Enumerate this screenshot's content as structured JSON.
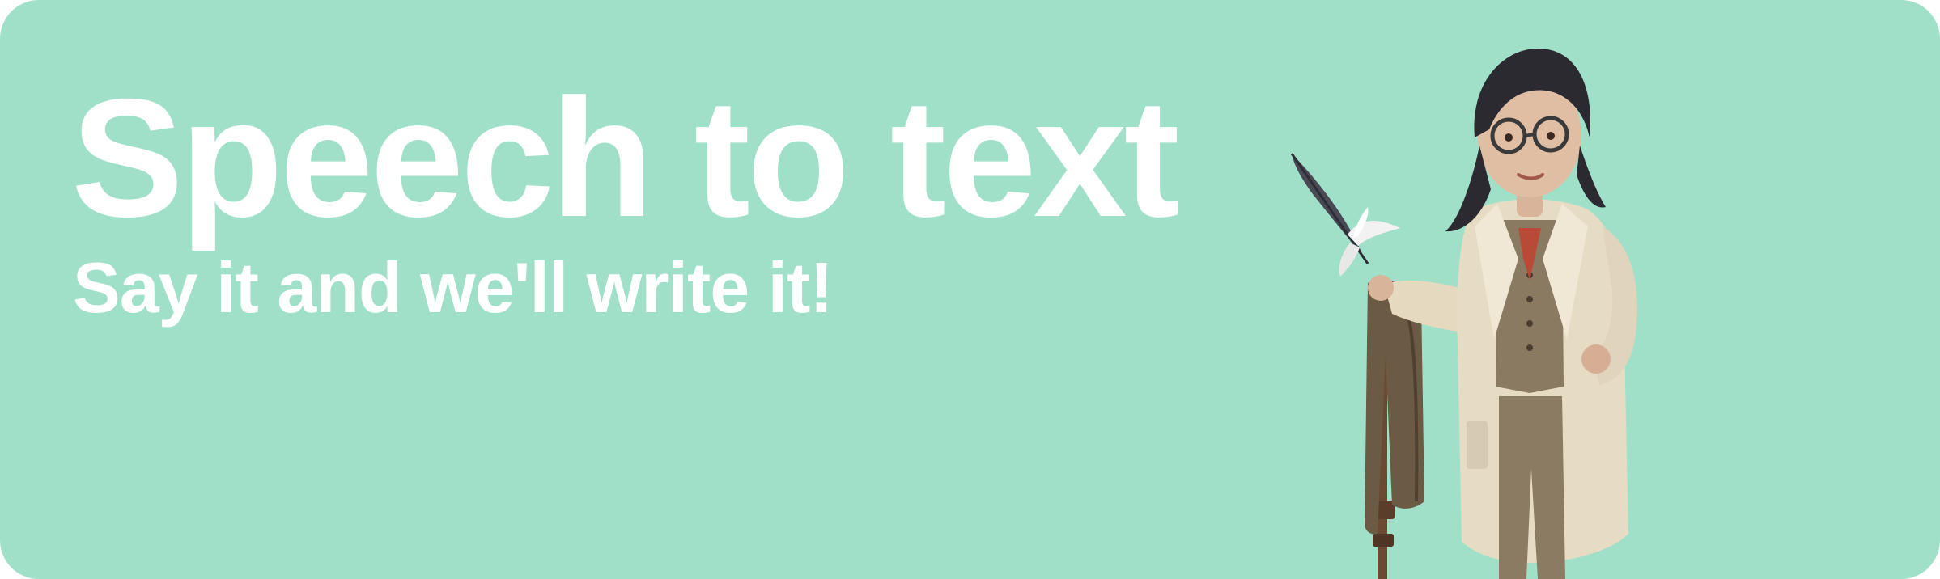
{
  "banner": {
    "title": "Speech to text",
    "subtitle": "Say it and we'll write it!",
    "background_color": "#a0e0c8",
    "text_color": "#ffffff"
  },
  "illustration": {
    "icon": "writer-character-with-quill-illustration"
  }
}
